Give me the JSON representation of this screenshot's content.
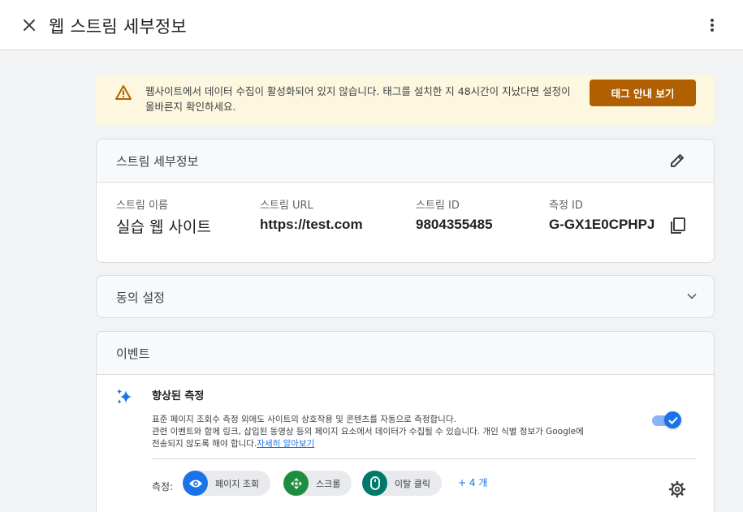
{
  "header": {
    "title": "웹 스트림 세부정보"
  },
  "banner": {
    "message": "웹사이트에서 데이터 수집이 활성화되어 있지 않습니다. 태그를 설치한 지 48시간이 지났다면 설정이 올바른지 확인하세요.",
    "button_label": "태그 안내 보기",
    "background_color": "#fef7e0",
    "button_color": "#b06000",
    "icon": "warning-icon"
  },
  "stream_details": {
    "title": "스트림 세부정보",
    "fields": [
      {
        "label": "스트림 이름",
        "value": "실습 웹 사이트"
      },
      {
        "label": "스트림 URL",
        "value": "https://test.com"
      },
      {
        "label": "스트림 ID",
        "value": "9804355485"
      },
      {
        "label": "측정 ID",
        "value": "G-GX1E0CPHPJ"
      }
    ]
  },
  "consent": {
    "title": "동의 설정"
  },
  "events": {
    "title": "이벤트",
    "enhanced": {
      "title": "향상된 측정",
      "description_line1": "표준 페이지 조회수 측정 외에도 사이트의 상호작용 및 콘텐츠를 자동으로 측정합니다.",
      "description_line2": "관련 이벤트와 함께 링크, 삽입된 동영상 등의 페이지 요소에서 데이터가 수집될 수 있습니다. 개인 식별 정보가 Google에",
      "description_line3": "전송되지 않도록 해야 합니다.",
      "learn_more": "자세히 알아보기",
      "enabled": true
    },
    "measure_label": "측정:",
    "chips": [
      {
        "label": "페이지 조회",
        "icon": "eye-icon",
        "color": "#1a73e8"
      },
      {
        "label": "스크롤",
        "icon": "scroll-icon",
        "color": "#1e8e3e"
      },
      {
        "label": "이탈 클릭",
        "icon": "mouse-icon",
        "color": "#00796b"
      }
    ],
    "more_label": "+ 4 개"
  }
}
